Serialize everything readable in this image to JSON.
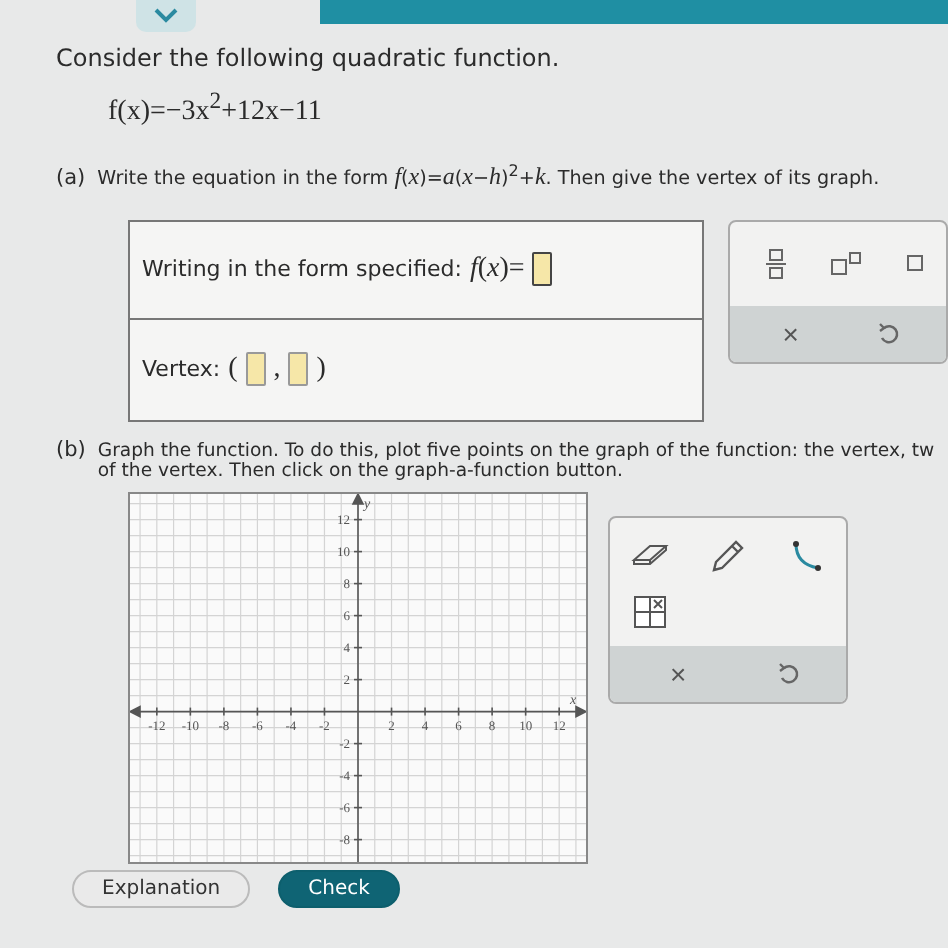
{
  "intro": "Consider the following quadratic function.",
  "function": "f(x)=−3x$^{2}$+12x−11",
  "part_a": {
    "tag": "(a)",
    "prompt": "Write the equation in the form *f*(*x*)=*a*(*x*−*h*)$^{2}$+*k*. Then give the vertex of its graph.",
    "form_label": "Writing in the form specified:",
    "form_lhs": "*f*(*x*)=",
    "vertex_label": "Vertex:",
    "open": "(",
    "sep": ",",
    "close": ")",
    "palette": {
      "clear": "×"
    }
  },
  "part_b": {
    "tag": "(b)",
    "lines": [
      "Graph the function. To do this, plot five points on the graph of the function: the vertex, tw",
      "of the vertex. Then click on the graph-a-function button."
    ],
    "x_axis": "x",
    "y_axis": "y",
    "x_ticks": [
      "-12",
      "-10",
      "-8",
      "-6",
      "-4",
      "-2",
      "2",
      "4",
      "6",
      "8",
      "10",
      "12"
    ],
    "y_ticks": [
      "12",
      "10",
      "8",
      "6",
      "4",
      "2",
      "-2",
      "-4",
      "-6",
      "-8"
    ],
    "tools_clear": "×"
  },
  "buttons": [
    "Explanation",
    "Check"
  ]
}
